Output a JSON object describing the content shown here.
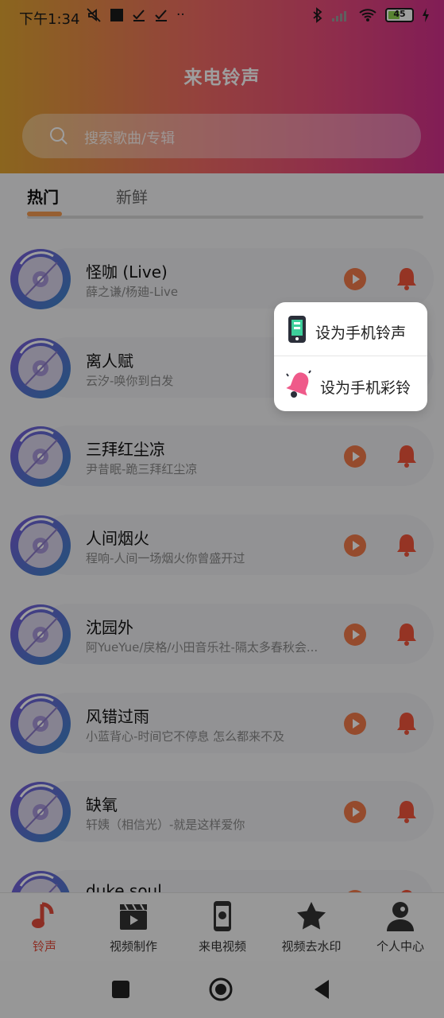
{
  "status_bar": {
    "time": "下午1:34",
    "battery": "45"
  },
  "header": {
    "title": "来电铃声",
    "search_placeholder": "搜索歌曲/专辑"
  },
  "tabs": [
    {
      "label": "热门",
      "active": true
    },
    {
      "label": "新鲜",
      "active": false
    }
  ],
  "songs": [
    {
      "title": "怪咖 (Live)",
      "subtitle": "薛之谦/杨廸-Live"
    },
    {
      "title": "离人赋",
      "subtitle": "云汐-唤你到白发"
    },
    {
      "title": "三拜红尘凉",
      "subtitle": "尹昔眠-跪三拜红尘凉"
    },
    {
      "title": "人间烟火",
      "subtitle": "程响-人间一场烟火你曾盛开过"
    },
    {
      "title": "沈园外",
      "subtitle": "阿YueYue/戾格/小田音乐社-隔太多春秋会..."
    },
    {
      "title": "风错过雨",
      "subtitle": "小蓝背心-时间它不停息 怎么都来不及"
    },
    {
      "title": "缺氧",
      "subtitle": "轩姨（相信光）-就是这样爱你"
    },
    {
      "title": "duke soul",
      "subtitle": ""
    }
  ],
  "popup": {
    "items": [
      {
        "label": "设为手机铃声",
        "icon": "phone-icon"
      },
      {
        "label": "设为手机彩铃",
        "icon": "bell-ring-icon"
      }
    ]
  },
  "bottom_nav": [
    {
      "label": "铃声",
      "icon": "music-note-icon",
      "active": true
    },
    {
      "label": "视频制作",
      "icon": "clapperboard-icon",
      "active": false
    },
    {
      "label": "来电视频",
      "icon": "phone-video-icon",
      "active": false
    },
    {
      "label": "视频去水印",
      "icon": "star-icon",
      "active": false
    },
    {
      "label": "个人中心",
      "icon": "person-icon",
      "active": false
    }
  ],
  "colors": {
    "accent": "#f29a52",
    "bell": "#f0553a",
    "play": "#f07a4a",
    "active_nav": "#e24b3a"
  }
}
